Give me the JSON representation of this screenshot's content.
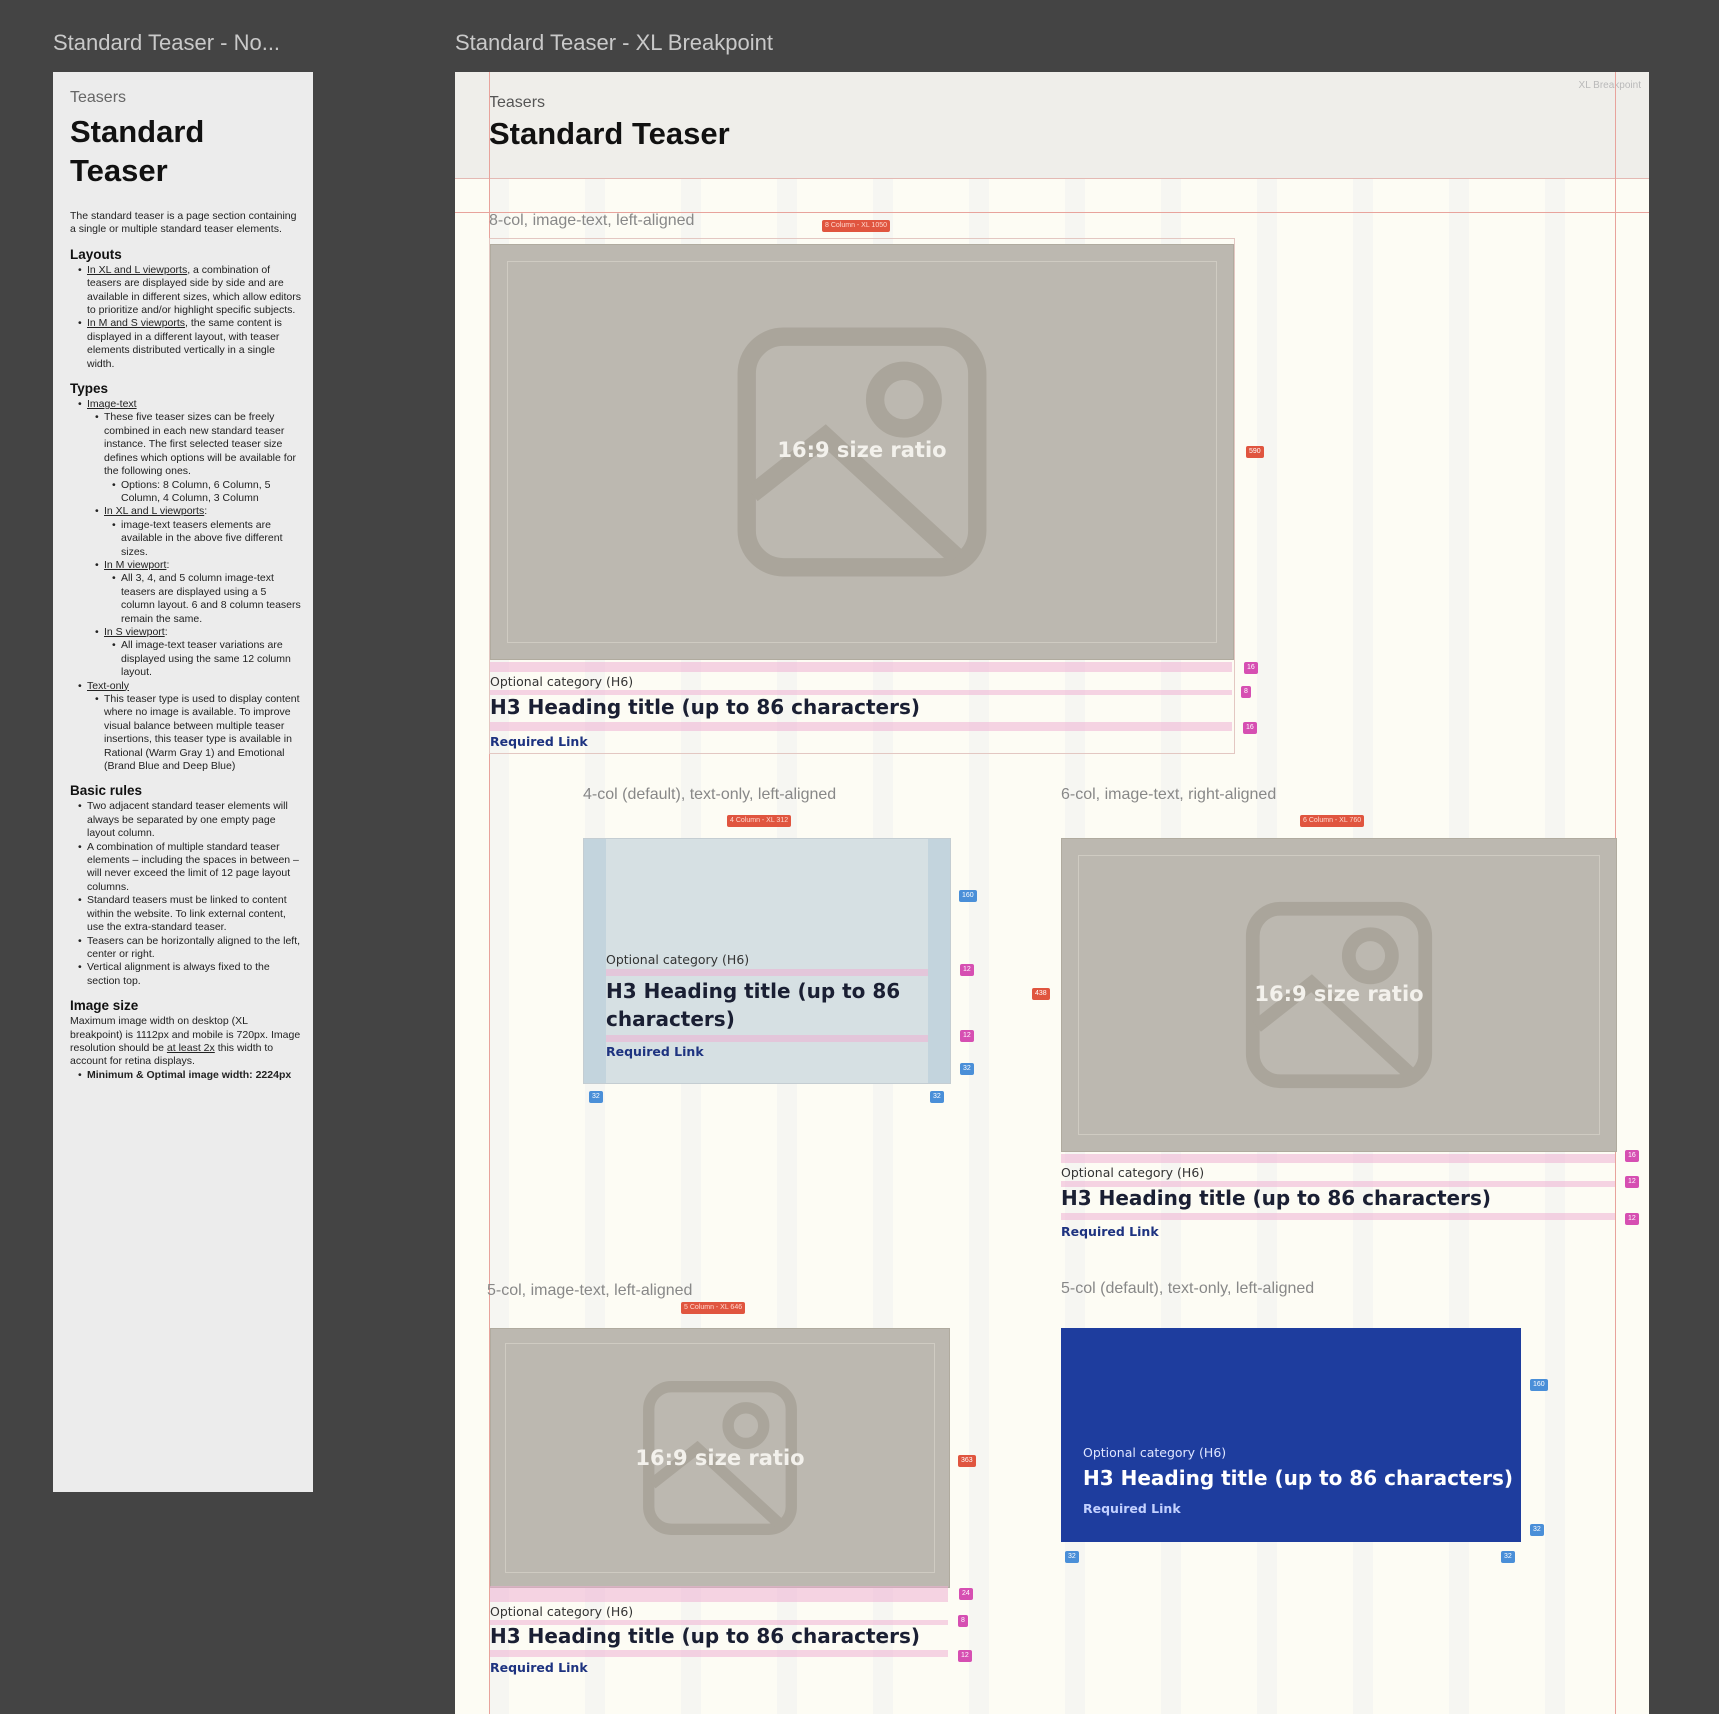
{
  "frames": {
    "left_label": "Standard Teaser - No...",
    "main_label": "Standard Teaser - XL Breakpoint"
  },
  "doc": {
    "eyebrow": "Teasers",
    "title": "Standard Teaser",
    "intro": "The standard teaser is a page section containing a single or multiple standard teaser elements.",
    "layouts": {
      "heading": "Layouts",
      "item1_link": "In XL and L viewports",
      "item1_text": ", a combination of teasers are displayed side by side and are available in different sizes, which allow editors to prioritize and/or highlight specific subjects.",
      "item2_link": "In M and S viewports",
      "item2_text": ", the same content is displayed in a different layout, with teaser elements distributed vertically in a single width."
    },
    "types": {
      "heading": "Types",
      "image_text": "Image-text",
      "it_desc": "These five teaser sizes can be freely combined in each new standard teaser instance. The first selected teaser size defines which options will be available for the following ones.",
      "it_options": "Options: 8 Column,  6 Column, 5 Column, 4 Column, 3 Column",
      "xl_l": "In XL and L viewports",
      "xl_l_desc": "image-text teasers elements are available in the above five different sizes.",
      "m": "In M viewport",
      "m_desc": "All 3, 4, and 5 column image-text teasers are displayed using a 5 column layout. 6 and 8 column teasers remain the same.",
      "s": "In S viewport",
      "s_desc": "All image-text teaser variations are displayed using the same 12 column layout.",
      "text_only": "Text-only",
      "to_desc": "This teaser type is used to display content where no image is available. To improve visual balance between multiple teaser insertions, this teaser type is available in Rational (Warm Gray 1) and Emotional (Brand Blue and Deep Blue)"
    },
    "rules": {
      "heading": "Basic rules",
      "r1": "Two adjacent standard teaser elements will always be separated by one empty page layout column.",
      "r2": "A combination of multiple standard teaser elements – including the spaces in between – will never exceed the limit of 12 page layout columns.",
      "r3": "Standard teasers must be linked to content within the website. To link external content, use the extra-standard teaser.",
      "r4": "Teasers can be horizontally aligned to the left, center or right.",
      "r5": "Vertical alignment is always fixed to the section top."
    },
    "image_size": {
      "heading": "Image size",
      "text_a": "Maximum image width on desktop (XL breakpoint) is 1112px and mobile is 720px. Image resolution should be ",
      "text_link": "at least 2x",
      "text_b": " this width to account for retina displays.",
      "bullet": "Minimum & Optimal image width: 2224px"
    }
  },
  "main": {
    "eyebrow": "Teasers",
    "title": "Standard Teaser",
    "breakpoint": "XL Breakpoint",
    "ratio_label": "16:9 size ratio",
    "category": "Optional category (H6)",
    "heading_a": "H3 Heading title (up to 86 characters)",
    "heading_b": "H3 Heading title (up to 86 characters)",
    "link": "Required Link",
    "sections": {
      "s8": "8-col, image-text, left-aligned",
      "s4": "4-col (default), text-only, left-aligned",
      "s6": "6-col, image-text, right-aligned",
      "s5i": "5-col, image-text, left-aligned",
      "s5t": "5-col (default), text-only, left-aligned"
    },
    "tags": {
      "c8": "8 Column - XL 1050",
      "c4": "4 Column - XL 312",
      "c6": "6 Column - XL 760",
      "c5": "5 Column - XL 646"
    },
    "measures": {
      "m590": "590",
      "m16": "16",
      "m8": "8",
      "m160": "160",
      "m12": "12",
      "m32": "32",
      "m438": "438",
      "m363": "363",
      "m24": "24"
    }
  }
}
